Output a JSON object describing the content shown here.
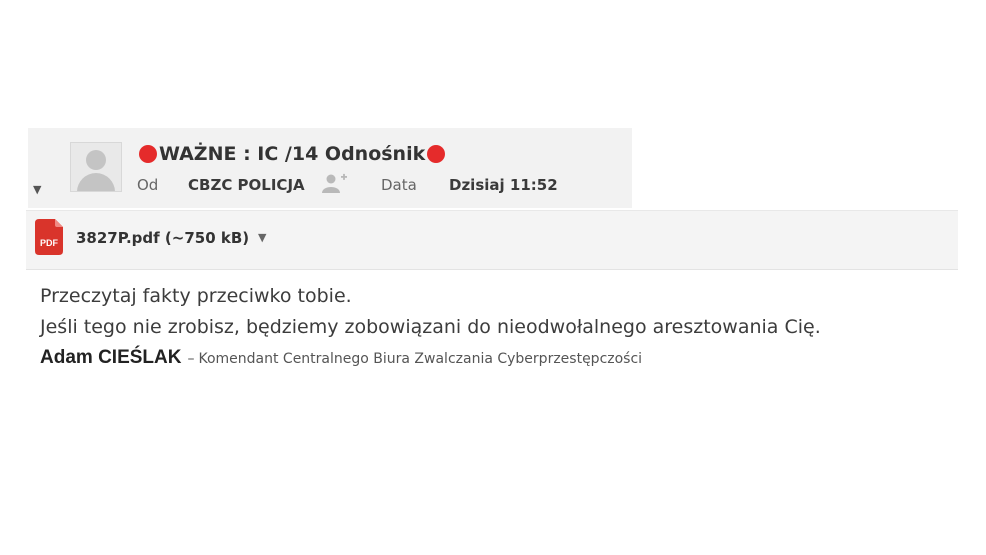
{
  "email": {
    "subject": "WAŻNE : IC /14 Odnośnik",
    "from_label": "Od",
    "from_value": "CBZC POLICJA",
    "date_label": "Data",
    "date_value": "Dzisiaj 11:52"
  },
  "attachment": {
    "file_name": "3827P.pdf (~750 kB)",
    "icon_text": "PDF"
  },
  "body": {
    "line1": "Przeczytaj fakty przeciwko tobie.",
    "line2": "Jeśli tego nie zrobisz, będziemy zobowiązani do nieodwołalnego aresztowania Cię."
  },
  "signature": {
    "name": "Adam CIEŚLAK",
    "dash": "–",
    "title": "Komendant Centralnego Biura Zwalczania Cyberprzestępczości"
  },
  "icons": {
    "alert_dot_color": "#e52b2b",
    "pdf_color": "#d9342b",
    "avatar": "avatar-placeholder-icon",
    "add_contact": "add-contact-icon",
    "collapse": "collapse-arrow-icon",
    "dropdown": "chevron-down-icon"
  }
}
